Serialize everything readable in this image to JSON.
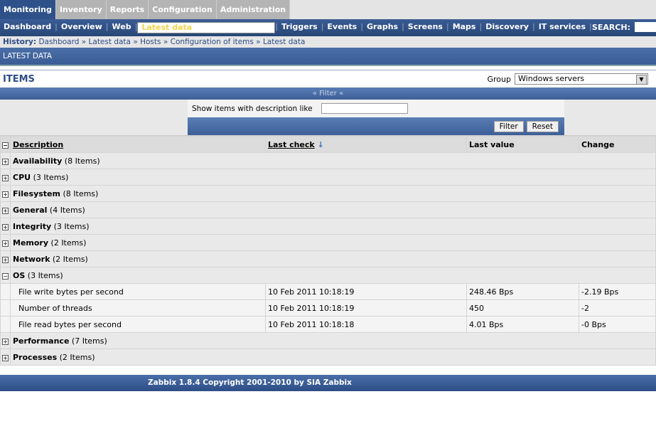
{
  "top_tabs": [
    "Monitoring",
    "Inventory",
    "Reports",
    "Configuration",
    "Administration"
  ],
  "nav": [
    "Dashboard",
    "Overview",
    "Web",
    "Latest data",
    "Triggers",
    "Events",
    "Graphs",
    "Screens",
    "Maps",
    "Discovery",
    "IT services"
  ],
  "search_label": "SEARCH:",
  "history": {
    "label": "History:",
    "items": [
      "Dashboard",
      "Latest data",
      "Hosts",
      "Configuration of items",
      "Latest data"
    ]
  },
  "section_title": "LATEST DATA",
  "items_title": "ITEMS",
  "group": {
    "label": "Group",
    "value": "Windows servers"
  },
  "filter": {
    "toggle": "Filter",
    "desc_label": "Show items with description like",
    "desc_value": "",
    "filter_btn": "Filter",
    "reset_btn": "Reset"
  },
  "columns": [
    "Description",
    "Last check",
    "Last value",
    "Change"
  ],
  "groups": [
    {
      "name": "Availability",
      "count": "(8 Items)",
      "expanded": false
    },
    {
      "name": "CPU",
      "count": "(3 Items)",
      "expanded": false
    },
    {
      "name": "Filesystem",
      "count": "(8 Items)",
      "expanded": false
    },
    {
      "name": "General",
      "count": "(4 Items)",
      "expanded": false
    },
    {
      "name": "Integrity",
      "count": "(3 Items)",
      "expanded": false
    },
    {
      "name": "Memory",
      "count": "(2 Items)",
      "expanded": false
    },
    {
      "name": "Network",
      "count": "(2 Items)",
      "expanded": false
    },
    {
      "name": "OS",
      "count": "(3 Items)",
      "expanded": true,
      "items": [
        {
          "desc": "File write bytes per second",
          "last_check": "10 Feb 2011 10:18:19",
          "last_value": "248.46 Bps",
          "change": "-2.19 Bps"
        },
        {
          "desc": "Number of threads",
          "last_check": "10 Feb 2011 10:18:19",
          "last_value": "450",
          "change": "-2"
        },
        {
          "desc": "File read bytes per second",
          "last_check": "10 Feb 2011 10:18:18",
          "last_value": "4.01 Bps",
          "change": "-0 Bps"
        }
      ]
    },
    {
      "name": "Performance",
      "count": "(7 Items)",
      "expanded": false
    },
    {
      "name": "Processes",
      "count": "(2 Items)",
      "expanded": false
    }
  ],
  "footer": "Zabbix 1.8.4 Copyright 2001-2010 by SIA Zabbix"
}
